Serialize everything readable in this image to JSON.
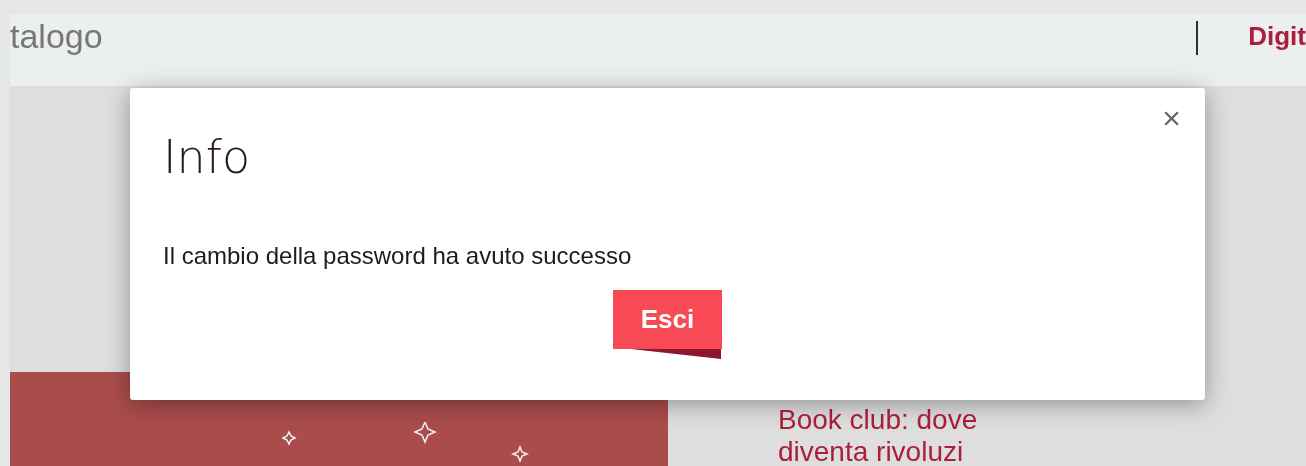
{
  "header": {
    "nav_text": "talogo",
    "brand_text": "Digit"
  },
  "page": {
    "headline_lines": [
      "Book club: dove",
      "diventa rivoluzi"
    ]
  },
  "dialog": {
    "title": "Info",
    "message": "Il cambio della password ha avuto successo",
    "close_label": "×",
    "button": "Esci"
  }
}
